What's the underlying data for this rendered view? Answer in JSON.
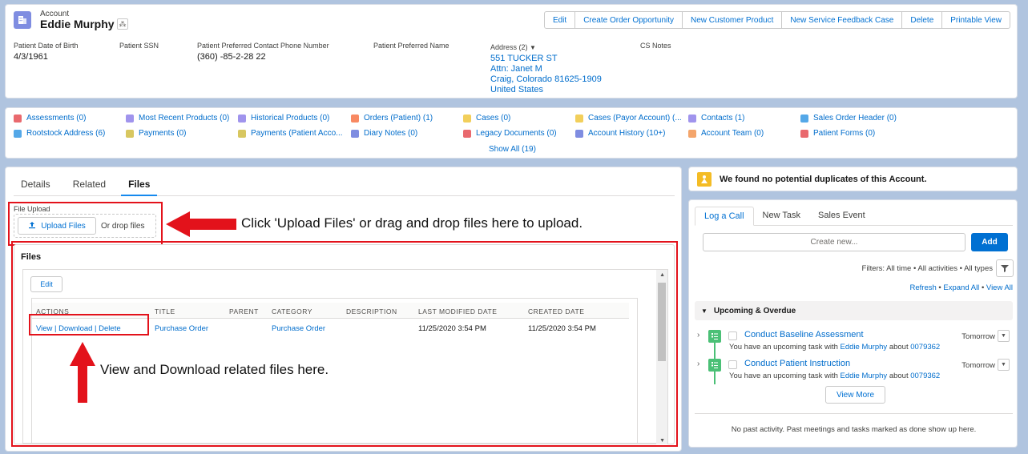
{
  "header": {
    "object_type": "Account",
    "record_name": "Eddie Murphy",
    "actions": [
      "Edit",
      "Create Order Opportunity",
      "New Customer Product",
      "New Service Feedback Case",
      "Delete",
      "Printable View"
    ],
    "fields": {
      "dob_label": "Patient Date of Birth",
      "dob_value": "4/3/1961",
      "ssn_label": "Patient SSN",
      "phone_label": "Patient Preferred Contact Phone Number",
      "phone_value": "(360) -85-2-28 22",
      "name_label": "Patient Preferred Name",
      "address_label": "Address (2)",
      "address_lines": [
        "551 TUCKER ST",
        "Attn: Janet M",
        "Craig, Colorado 81625-1909",
        "United States"
      ],
      "notes_label": "CS Notes"
    }
  },
  "related_links": {
    "items": [
      {
        "label": "Assessments (0)",
        "color": "#e9696e"
      },
      {
        "label": "Most Recent Products (0)",
        "color": "#a094ed"
      },
      {
        "label": "Historical Products (0)",
        "color": "#a094ed"
      },
      {
        "label": "Orders (Patient) (1)",
        "color": "#f88962"
      },
      {
        "label": "Cases (0)",
        "color": "#f2cf5b"
      },
      {
        "label": "Cases (Payor Account) (...",
        "color": "#f2cf5b"
      },
      {
        "label": "Contacts (1)",
        "color": "#a094ed"
      },
      {
        "label": "Sales Order Header (0)",
        "color": "#54a8e8"
      },
      {
        "label": "Rootstock Address (6)",
        "color": "#54a8e8"
      },
      {
        "label": "Payments (0)",
        "color": "#d8c760"
      },
      {
        "label": "Payments (Patient Acco...",
        "color": "#d8c760"
      },
      {
        "label": "Diary Notes (0)",
        "color": "#7f8de1"
      },
      {
        "label": "Legacy Documents (0)",
        "color": "#e9696e"
      },
      {
        "label": "Account History (10+)",
        "color": "#7f8de1"
      },
      {
        "label": "Account Team (0)",
        "color": "#f4a56b"
      },
      {
        "label": "Patient Forms (0)",
        "color": "#e9696e"
      }
    ],
    "show_all": "Show All (19)"
  },
  "main": {
    "tabs": [
      "Details",
      "Related",
      "Files"
    ],
    "active_tab": "Files",
    "file_upload_label": "File Upload",
    "upload_button": "Upload Files",
    "drop_text": "Or drop files",
    "files_title": "Files",
    "edit_button": "Edit",
    "columns": [
      "ACTIONS",
      "TITLE",
      "PARENT",
      "CATEGORY",
      "DESCRIPTION",
      "LAST MODIFIED DATE",
      "CREATED DATE"
    ],
    "row": {
      "actions": "View | Download | Delete",
      "title": "Purchase Order",
      "parent": "",
      "category": "Purchase Order",
      "description": "",
      "last_modified": "11/25/2020 3:54 PM",
      "created": "11/25/2020 3:54 PM"
    }
  },
  "annotations": {
    "upload_hint": "Click 'Upload Files' or drag and drop files here to upload.",
    "view_hint": "View and Download related files here."
  },
  "duplicates": {
    "text": "We found no potential duplicates of this Account."
  },
  "activity": {
    "tabs": [
      "Log a Call",
      "New Task",
      "Sales Event"
    ],
    "create_placeholder": "Create new...",
    "add_button": "Add",
    "filters": "Filters: All time • All activities • All types",
    "refresh": "Refresh",
    "expand_all": "Expand All",
    "view_all": "View All",
    "section": "Upcoming & Overdue",
    "tasks": [
      {
        "subject": "Conduct Baseline Assessment",
        "date": "Tomorrow",
        "desc_prefix": "You have an upcoming task with",
        "who": "Eddie Murphy",
        "about": "about",
        "ref": "0079362"
      },
      {
        "subject": "Conduct Patient Instruction",
        "date": "Tomorrow",
        "desc_prefix": "You have an upcoming task with",
        "who": "Eddie Murphy",
        "about": "about",
        "ref": "0079362"
      }
    ],
    "view_more": "View More",
    "past_text": "No past activity. Past meetings and tasks marked as done show up here."
  }
}
